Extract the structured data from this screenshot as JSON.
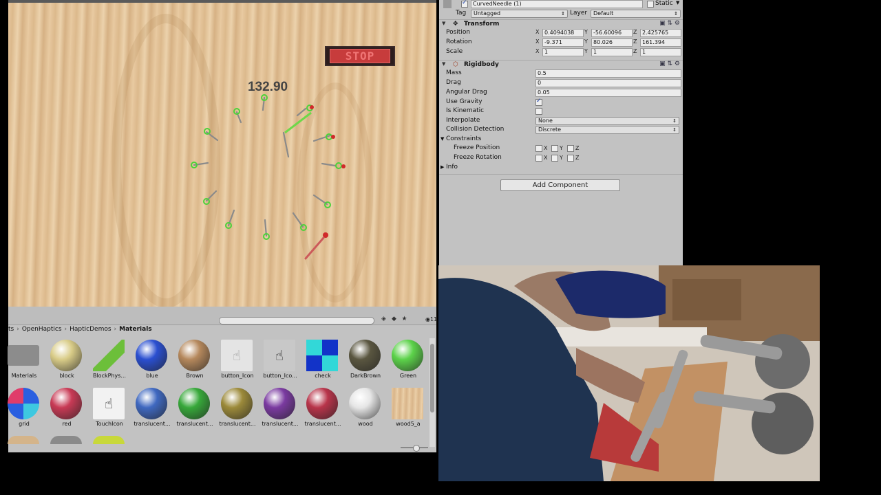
{
  "game": {
    "timer": "132.90",
    "stop_label": "STOP"
  },
  "project": {
    "item_count": "11",
    "breadcrumb": [
      "ts",
      "OpenHaptics",
      "HapticDemos",
      "Materials"
    ],
    "assets_row1": [
      {
        "name": "Materials",
        "kind": "folder"
      },
      {
        "name": "block",
        "kind": "sphere",
        "color": "#d9cc88"
      },
      {
        "name": "BlockPhys...",
        "kind": "icon"
      },
      {
        "name": "blue",
        "kind": "sphere",
        "color": "#2a4fd0"
      },
      {
        "name": "Brown",
        "kind": "sphere",
        "color": "#b5885c"
      },
      {
        "name": "button_Icon",
        "kind": "hand"
      },
      {
        "name": "button_Ico...",
        "kind": "hand-dark"
      },
      {
        "name": "check",
        "kind": "check"
      },
      {
        "name": "DarkBrown",
        "kind": "sphere",
        "color": "#5a5640"
      },
      {
        "name": "Green",
        "kind": "sphere",
        "color": "#5cd24a"
      }
    ],
    "assets_row2": [
      {
        "name": "grid",
        "kind": "grid"
      },
      {
        "name": "red",
        "kind": "sphere",
        "color": "#c83a55"
      },
      {
        "name": "TouchIcon",
        "kind": "touch"
      },
      {
        "name": "translucent...",
        "kind": "sphere",
        "color": "#3f68c0"
      },
      {
        "name": "translucent...",
        "kind": "sphere",
        "color": "#37a83a"
      },
      {
        "name": "translucent...",
        "kind": "sphere",
        "color": "#9c8a3a"
      },
      {
        "name": "translucent...",
        "kind": "sphere",
        "color": "#7a3aa0"
      },
      {
        "name": "translucent...",
        "kind": "sphere",
        "color": "#b8344a"
      },
      {
        "name": "wood",
        "kind": "sphere",
        "color": "#e6e6e6"
      },
      {
        "name": "wood5_a",
        "kind": "wood"
      }
    ]
  },
  "inspector": {
    "object_name": "CurvedNeedle (1)",
    "static_label": "Static",
    "tag_label": "Tag",
    "tag_value": "Untagged",
    "layer_label": "Layer",
    "layer_value": "Default",
    "transform": {
      "title": "Transform",
      "position_label": "Position",
      "rotation_label": "Rotation",
      "scale_label": "Scale",
      "position": {
        "x": "0.4094038",
        "y": "-56.60096",
        "z": "2.425765"
      },
      "rotation": {
        "x": "-9.371",
        "y": "80.026",
        "z": "161.394"
      },
      "scale": {
        "x": "1",
        "y": "1",
        "z": "1"
      },
      "axis_x": "X",
      "axis_y": "Y",
      "axis_z": "Z"
    },
    "rigidbody": {
      "title": "Rigidbody",
      "mass_label": "Mass",
      "mass": "0.5",
      "drag_label": "Drag",
      "drag": "0",
      "angular_drag_label": "Angular Drag",
      "angular_drag": "0.05",
      "use_gravity_label": "Use Gravity",
      "use_gravity": true,
      "is_kinematic_label": "Is Kinematic",
      "is_kinematic": false,
      "interpolate_label": "Interpolate",
      "interpolate": "None",
      "collision_label": "Collision Detection",
      "collision": "Discrete",
      "constraints_label": "Constraints",
      "freeze_position_label": "Freeze Position",
      "freeze_rotation_label": "Freeze Rotation",
      "info_label": "Info"
    },
    "add_component": "Add Component"
  }
}
